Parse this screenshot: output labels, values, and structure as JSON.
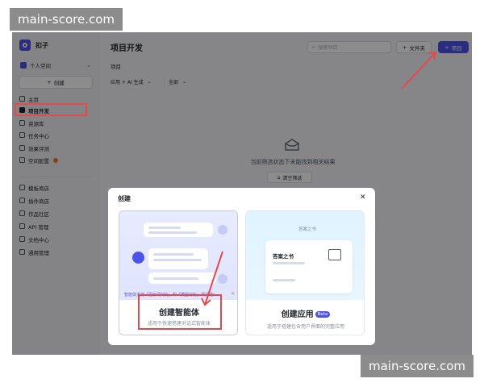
{
  "watermark": {
    "top": "main-score.com",
    "bottom": "main-score.com"
  },
  "sidebar": {
    "brand": "扣子",
    "workspace": "个人空间",
    "create_label": "创建",
    "nav_primary": [
      {
        "label": "主页",
        "icon": "home-icon"
      },
      {
        "label": "项目开发",
        "icon": "project-icon",
        "active": true
      },
      {
        "label": "资源库",
        "icon": "library-icon"
      },
      {
        "label": "任务中心",
        "icon": "task-icon"
      },
      {
        "label": "效果评测",
        "icon": "evaluate-icon"
      },
      {
        "label": "空间配置",
        "icon": "settings-icon",
        "badge": true
      }
    ],
    "nav_secondary": [
      {
        "label": "模板商店",
        "icon": "template-icon"
      },
      {
        "label": "插件商店",
        "icon": "plugin-icon"
      },
      {
        "label": "作品社区",
        "icon": "community-icon"
      },
      {
        "label": "API 管理",
        "icon": "api-icon"
      },
      {
        "label": "文档中心",
        "icon": "docs-icon"
      },
      {
        "label": "通用管理",
        "icon": "admin-icon"
      }
    ]
  },
  "main": {
    "title": "项目开发",
    "search_placeholder": "搜索项目",
    "folder_button": "文件夹",
    "project_button": "项目",
    "section_label": "项目",
    "filter_type": "应用 + AI 生成",
    "filter_scope": "全部",
    "empty_text": "当前筛选状态下未能找到相关结果",
    "clear_filter": "清空筛选"
  },
  "modal": {
    "title": "创建",
    "cards": [
      {
        "title": "创建智能体",
        "subtitle": "适用于快速搭建对话式智能体",
        "hint": "智能体支持「提示词对比」和「模型对比」调试啦!"
      },
      {
        "title": "创建应用",
        "badge": "Beta",
        "subtitle": "适用于搭建包含用户界面的完整应用",
        "preview_heading": "答案之书",
        "preview_card_title": "答案之书"
      }
    ]
  },
  "colors": {
    "accent": "#4d53e8",
    "annotation": "#e5484d"
  }
}
